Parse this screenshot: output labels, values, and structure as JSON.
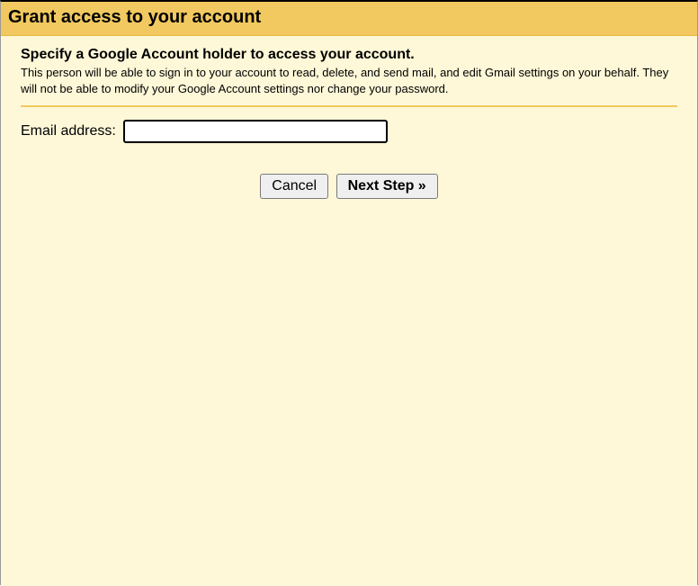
{
  "header": {
    "title": "Grant access to your account"
  },
  "intro": {
    "subtitle": "Specify a Google Account holder to access your account.",
    "description": "This person will be able to sign in to your account to read, delete, and send mail, and edit Gmail settings on your behalf. They will not be able to modify your Google Account settings nor change your password."
  },
  "form": {
    "email_label": "Email address:",
    "email_value": ""
  },
  "buttons": {
    "cancel": "Cancel",
    "next": "Next Step »"
  }
}
